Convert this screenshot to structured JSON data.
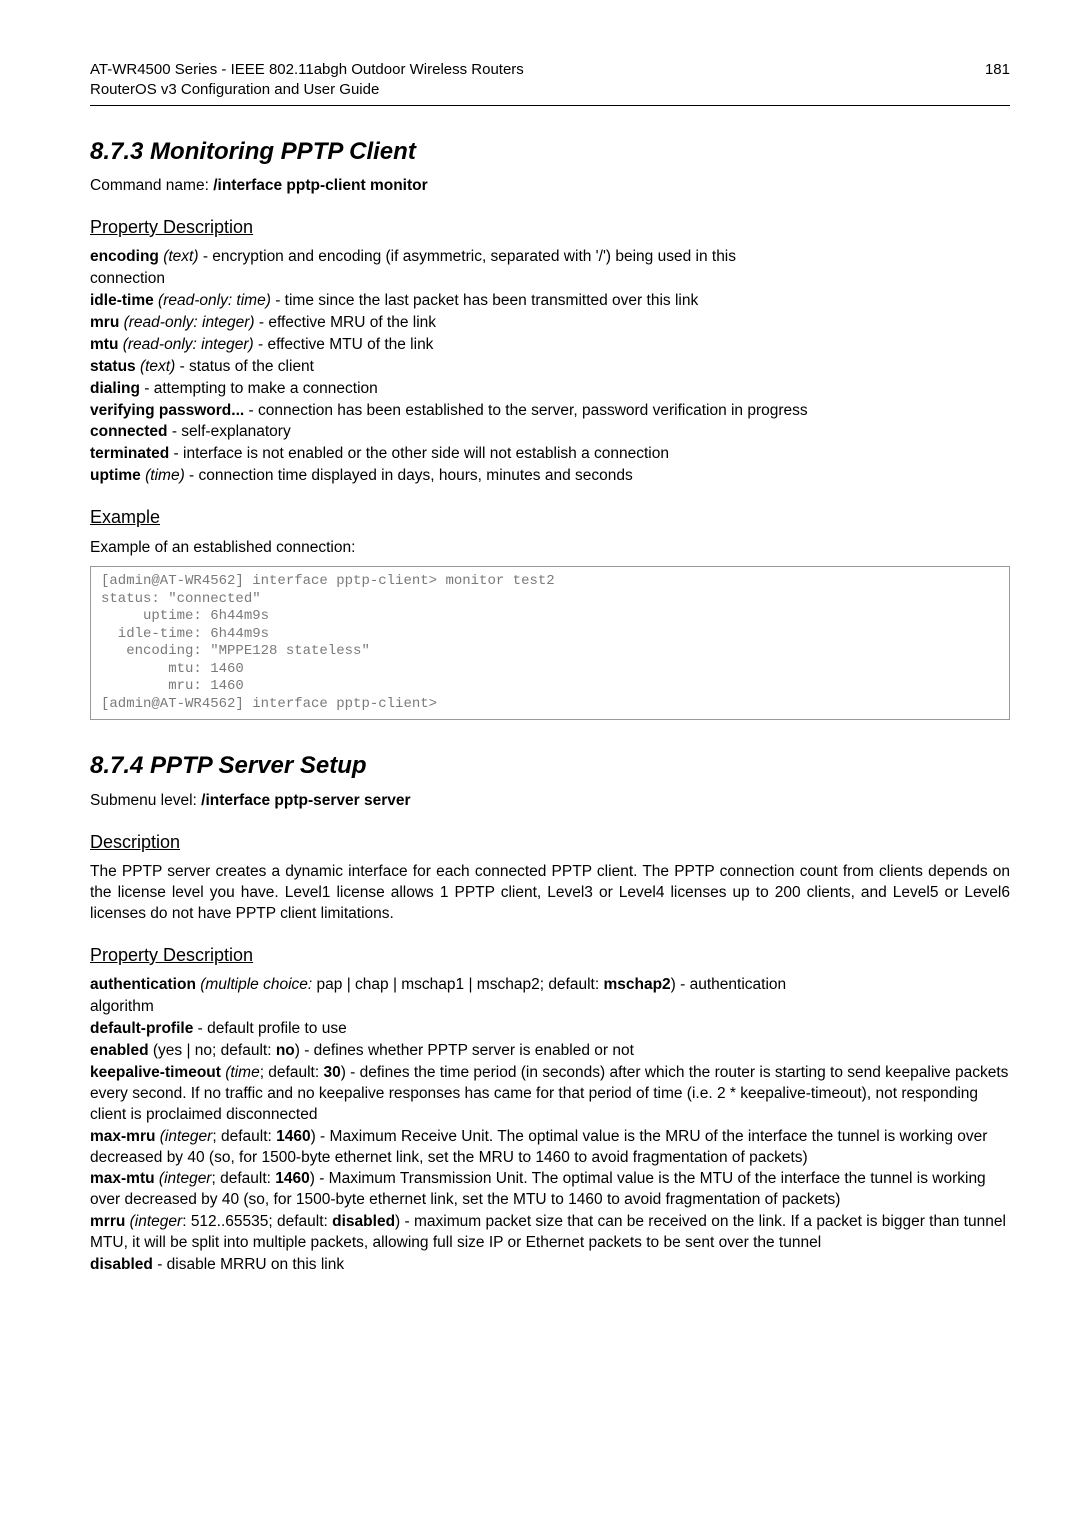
{
  "header": {
    "left1": "AT-WR4500 Series - IEEE 802.11abgh Outdoor Wireless Routers",
    "left2": "RouterOS v3 Configuration and User Guide",
    "right": "181"
  },
  "s1": {
    "title": "8.7.3 Monitoring PPTP Client",
    "cmd_label": "Command name: ",
    "cmd_value": "/interface pptp-client monitor",
    "pd_title": "Property Description",
    "encoding_k": "encoding",
    "encoding_t": " (text)",
    "encoding_d1": " - encryption and encoding (if asymmetric, separated with '/') being used in this",
    "encoding_d2": "connection",
    "idle_k": "idle-time",
    "idle_t": " (read-only: time)",
    "idle_d": " - time since the last packet has been transmitted over this link",
    "mru_k": "mru",
    "mru_t": " (read-only: integer)",
    "mru_d": " - effective MRU of the link",
    "mtu_k": "mtu",
    "mtu_t": " (read-only: integer)",
    "mtu_d": " - effective MTU of the link",
    "status_k": "status",
    "status_t": " (text)",
    "status_d": " - status of the client",
    "dialing_k": "dialing",
    "dialing_d": " - attempting to make a connection",
    "verify_k": "verifying password...",
    "verify_d": " - connection has been established to the server, password verification in progress",
    "conn_k": "connected",
    "conn_d": " - self-explanatory",
    "term_k": "terminated",
    "term_d": " - interface is not enabled or the other side will not establish a connection",
    "uptime_k": "uptime",
    "uptime_t": " (time)",
    "uptime_d": " - connection time displayed in days, hours, minutes and seconds",
    "ex_title": "Example",
    "ex_intro": "Example of an established connection:",
    "code": "[admin@AT-WR4562] interface pptp-client> monitor test2\nstatus: \"connected\"\n     uptime: 6h44m9s\n  idle-time: 6h44m9s\n   encoding: \"MPPE128 stateless\"\n        mtu: 1460\n        mru: 1460\n[admin@AT-WR4562] interface pptp-client>"
  },
  "s2": {
    "title": "8.7.4 PPTP Server Setup",
    "sub_label": "Submenu level: ",
    "sub_value": "/interface pptp-server server",
    "desc_title": "Description",
    "desc_body": "The PPTP server creates a dynamic interface for each connected PPTP client. The PPTP connection count from clients depends on the license level you have. Level1 license allows 1 PPTP client, Level3 or Level4 licenses up to 200 clients, and Level5 or Level6 licenses do not have PPTP client limitations.",
    "pd_title": "Property Description",
    "auth_k": "authentication",
    "auth_t": " (multiple choice:",
    "auth_opts": " pap | chap | mschap1 | mschap2; default: ",
    "auth_def": "mschap2",
    "auth_d1": ") - authentication",
    "auth_d2": "algorithm",
    "dprof_k": "default-profile",
    "dprof_d": " - default profile to use",
    "en_k": "enabled",
    "en_opts": " (yes | no; default: ",
    "en_def": "no",
    "en_d": ") - defines whether PPTP server is enabled or not",
    "ka_k": "keepalive-timeout",
    "ka_t": " (time",
    "ka_sep": "; default: ",
    "ka_def": "30",
    "ka_d": ") - defines the time period (in seconds) after which the router is starting to send keepalive packets every second. If no traffic and no keepalive responses has came for that period of time (i.e. 2 * keepalive-timeout), not responding client is proclaimed disconnected",
    "mmru_k": "max-mru",
    "mmru_t": " (integer",
    "mmru_sep": "; default: ",
    "mmru_def": "1460",
    "mmru_d": ") - Maximum Receive Unit. The optimal value is the MRU of the interface the tunnel is working over decreased by 40 (so, for 1500-byte ethernet link, set the MRU to 1460 to avoid fragmentation of packets)",
    "mmtu_k": "max-mtu",
    "mmtu_t": " (integer",
    "mmtu_sep": "; default: ",
    "mmtu_def": "1460",
    "mmtu_d": ") - Maximum Transmission Unit. The optimal value is the MTU of the interface the tunnel is working over decreased by 40 (so, for 1500-byte ethernet link, set the MTU to 1460 to avoid fragmentation of packets)",
    "mrru_k": "mrru",
    "mrru_t": " (integer",
    "mrru_sep1": ": 512..65535; default: ",
    "mrru_def": "disabled",
    "mrru_d": ") - maximum packet size that can be received on the link. If a packet is bigger than tunnel MTU, it will be split into multiple packets, allowing full size IP or Ethernet packets to be sent over the tunnel",
    "dis_k": "disabled",
    "dis_d": " - disable MRRU on this link"
  }
}
